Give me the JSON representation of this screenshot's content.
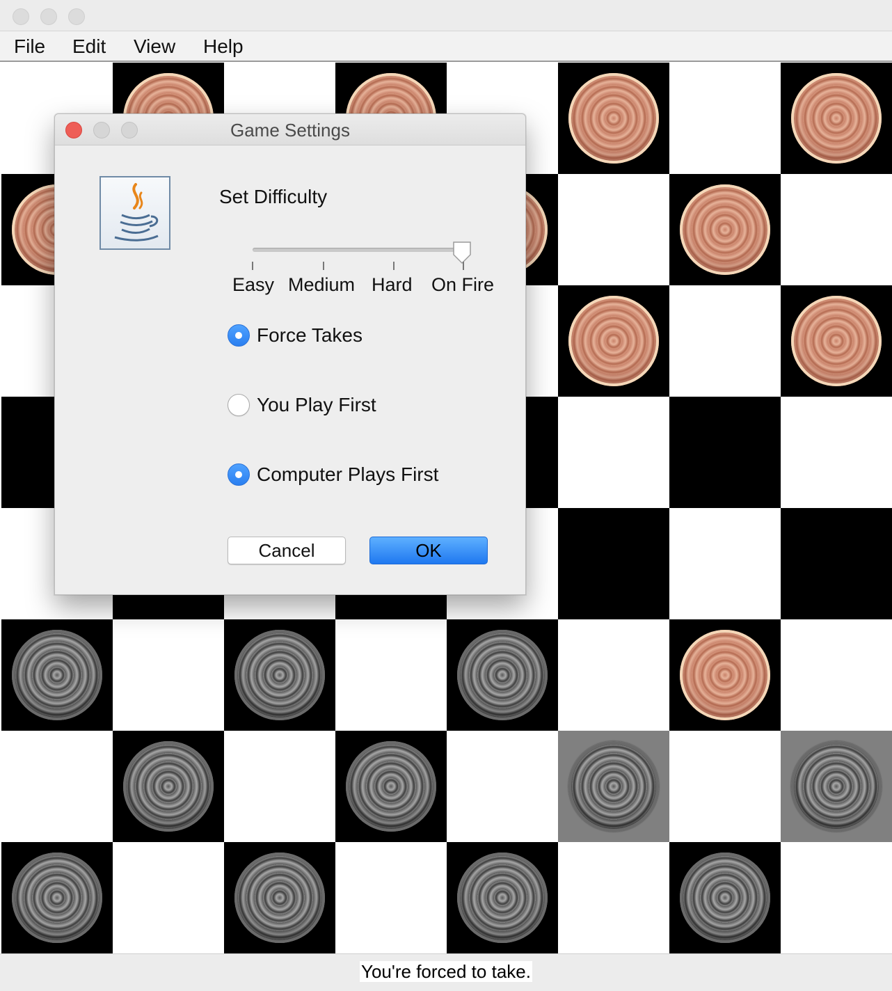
{
  "window": {
    "traffic_lights": [
      "close-button",
      "minimize-button",
      "zoom-button"
    ]
  },
  "menu": {
    "items": [
      {
        "label": "File"
      },
      {
        "label": "Edit"
      },
      {
        "label": "View"
      },
      {
        "label": "Help"
      }
    ]
  },
  "board": {
    "rows": 8,
    "cols": 8,
    "colors": {
      "dark": "#000000",
      "light": "#ffffff",
      "highlight": "#808080"
    },
    "pieces": [
      {
        "row": 0,
        "col": 1,
        "color": "red"
      },
      {
        "row": 0,
        "col": 3,
        "color": "red"
      },
      {
        "row": 0,
        "col": 5,
        "color": "red"
      },
      {
        "row": 0,
        "col": 7,
        "color": "red"
      },
      {
        "row": 1,
        "col": 0,
        "color": "red"
      },
      {
        "row": 1,
        "col": 4,
        "color": "red"
      },
      {
        "row": 1,
        "col": 6,
        "color": "red"
      },
      {
        "row": 2,
        "col": 5,
        "color": "red"
      },
      {
        "row": 2,
        "col": 7,
        "color": "red"
      },
      {
        "row": 5,
        "col": 0,
        "color": "gray"
      },
      {
        "row": 5,
        "col": 2,
        "color": "gray"
      },
      {
        "row": 5,
        "col": 4,
        "color": "gray"
      },
      {
        "row": 5,
        "col": 6,
        "color": "red"
      },
      {
        "row": 6,
        "col": 1,
        "color": "gray"
      },
      {
        "row": 6,
        "col": 3,
        "color": "gray"
      },
      {
        "row": 6,
        "col": 5,
        "color": "gray"
      },
      {
        "row": 6,
        "col": 7,
        "color": "gray"
      },
      {
        "row": 7,
        "col": 0,
        "color": "gray"
      },
      {
        "row": 7,
        "col": 2,
        "color": "gray"
      },
      {
        "row": 7,
        "col": 4,
        "color": "gray"
      },
      {
        "row": 7,
        "col": 6,
        "color": "gray"
      }
    ],
    "highlighted": [
      {
        "row": 6,
        "col": 5
      },
      {
        "row": 6,
        "col": 7
      }
    ]
  },
  "status": {
    "text": "You're forced to take."
  },
  "dialog": {
    "title": "Game Settings",
    "icon": "java-icon",
    "difficulty_label": "Set Difficulty",
    "difficulty_options": [
      "Easy",
      "Medium",
      "Hard",
      "On Fire"
    ],
    "difficulty_selected": "On Fire",
    "options": [
      {
        "label": "Force Takes",
        "checked": true
      },
      {
        "label": "You Play First",
        "checked": false
      },
      {
        "label": "Computer Plays First",
        "checked": true
      }
    ],
    "cancel_label": "Cancel",
    "ok_label": "OK",
    "accent": "#2a7ff0"
  }
}
